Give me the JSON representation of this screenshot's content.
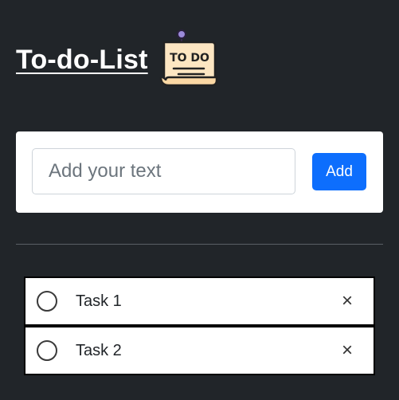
{
  "header": {
    "title": "To-do-List",
    "logo_text": "TO DO"
  },
  "input_card": {
    "placeholder": "Add your text",
    "value": "",
    "add_label": "Add"
  },
  "tasks": [
    {
      "label": "Task 1",
      "done": false,
      "delete_symbol": "×"
    },
    {
      "label": "Task 2",
      "done": false,
      "delete_symbol": "×"
    }
  ],
  "colors": {
    "background": "#212529",
    "accent": "#0d6efd",
    "card": "#ffffff"
  },
  "icons": {
    "logo": "todo-note-icon",
    "checkbox": "circle-outline-icon",
    "delete": "close-icon"
  }
}
